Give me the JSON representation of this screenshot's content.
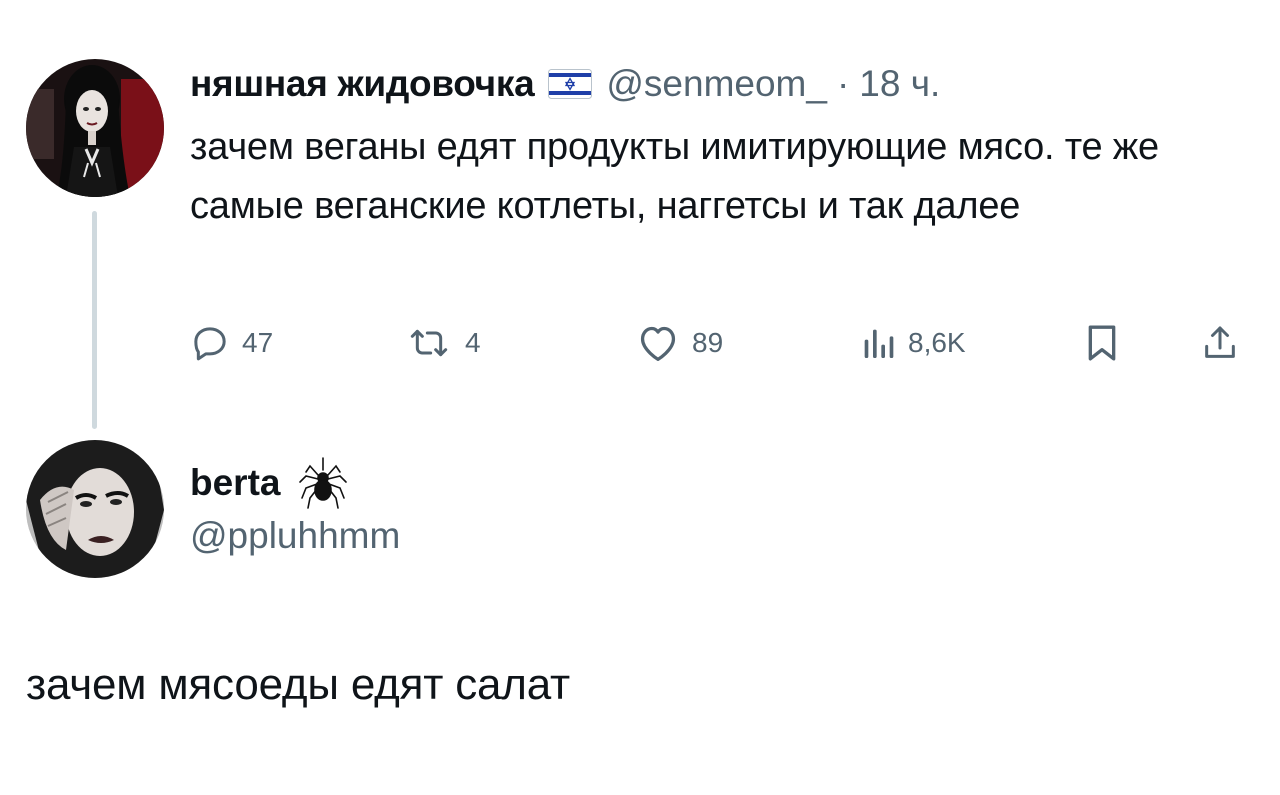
{
  "parent_tweet": {
    "author": {
      "display_name": "няшная жидовочка",
      "flag_icon": "israel-flag-icon",
      "handle": "@senmeom_",
      "separator": "·",
      "time": "18 ч."
    },
    "text": "зачем веганы едят продукты имитирующие мясо. те же самые веганские котлеты, наггетсы и так далее",
    "actions": {
      "reply": {
        "icon": "reply-icon",
        "count": "47"
      },
      "retweet": {
        "icon": "retweet-icon",
        "count": "4"
      },
      "like": {
        "icon": "heart-icon",
        "count": "89"
      },
      "views": {
        "icon": "views-icon",
        "count": "8,6K"
      },
      "bookmark": {
        "icon": "bookmark-icon"
      },
      "share": {
        "icon": "share-icon"
      }
    }
  },
  "reply_tweet": {
    "author": {
      "display_name": "berta",
      "emoji_icon": "spider-icon",
      "handle": "@ppluhhmm"
    },
    "text": "зачем мясоеды едят салат"
  },
  "colors": {
    "text_primary": "#0f1419",
    "text_secondary": "#536471",
    "thread_line": "#cfd9de",
    "flag_blue": "#1f3fa8"
  }
}
